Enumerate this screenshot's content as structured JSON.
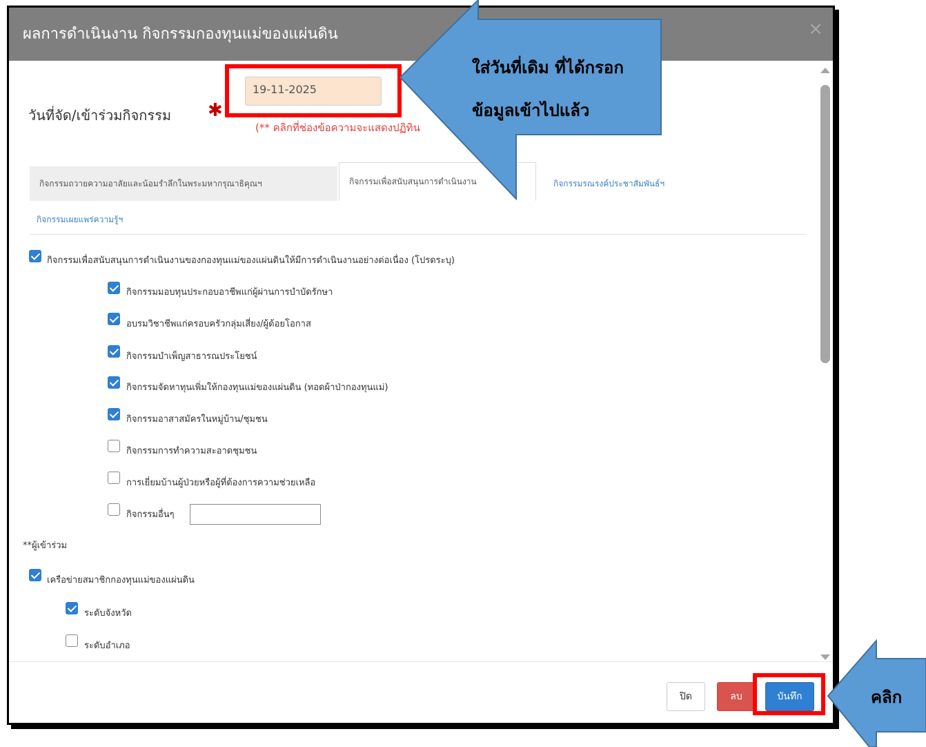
{
  "modal": {
    "title": "ผลการดำเนินงาน กิจกรรมกองทุนแม่ของแผ่นดิน",
    "close_glyph": "×"
  },
  "form": {
    "date_label": "วันที่จัด/เข้าร่วมกิจกรรม",
    "required_mark": "✱",
    "date_value": "19-11-2025",
    "hint": "(** คลิกที่ช่องข้อความจะแสดงปฏิทิน"
  },
  "tabs": [
    {
      "label": "กิจกรรมถวายความอาลัยและน้อมรำลึกในพระมหากรุณาธิคุณฯ",
      "state": "inactive"
    },
    {
      "label": "กิจกรรมเพื่อสนับสนุนการดำเนินงาน",
      "state": "active"
    },
    {
      "label": "กิจกรรมรณรงค์ประชาสัมพันธ์ฯ",
      "state": "link"
    },
    {
      "label": "กิจกรรมเผยแพร่ความรู้ฯ",
      "state": "link"
    }
  ],
  "main_checkbox": {
    "label": "กิจกรรมเพื่อสนับสนุนการดำเนินงานของกองทุนแม่ของแผ่นดินให้มีการดำเนินงานอย่างต่อเนื่อง (โปรดระบุ)",
    "checked": true
  },
  "sub_items": [
    {
      "label": "กิจกรรมมอบทุนประกอบอาชีพแก่ผู้ผ่านการบำบัดรักษา",
      "checked": true
    },
    {
      "label": "อบรมวิชาชีพแก่ครอบครัวกลุ่มเสี่ยง/ผู้ด้อยโอกาส",
      "checked": true
    },
    {
      "label": "กิจกรรมบำเพ็ญสาธารณประโยชน์",
      "checked": true
    },
    {
      "label": "กิจกรรมจัดหาทุนเพิ่มให้กองทุนแม่ของแผ่นดิน (ทอดผ้าป่ากองทุนแม่)",
      "checked": true
    },
    {
      "label": "กิจกรรมอาสาสมัครในหมู่บ้าน/ชุมชน",
      "checked": true
    },
    {
      "label": "กิจกรรมการทำความสะอาดชุมชน",
      "checked": false
    },
    {
      "label": "การเยี่ยมบ้านผู้ป่วยหรือผู้ที่ต้องการความช่วยเหลือ",
      "checked": false
    },
    {
      "label": "กิจกรรมอื่นๆ",
      "checked": false
    }
  ],
  "participants": {
    "heading": "**ผู้เข้าร่วม",
    "network": {
      "label": "เครือข่ายสมาชิกกองทุนแม่ของแผ่นดิน",
      "checked": true
    },
    "levels": [
      {
        "label": "ระดับจังหวัด",
        "checked": true
      },
      {
        "label": "ระดับอำเภอ",
        "checked": false
      }
    ]
  },
  "footer": {
    "close_label": "ปิด",
    "delete_label": "ลบ",
    "save_label": "บันทึก"
  },
  "annotations": {
    "arrow_top_line1": "ใส่วันที่เดิม ที่ได้กรอก",
    "arrow_top_line2": "ข้อมูลเข้าไปแล้ว",
    "arrow_bottom": "คลิก",
    "arrow_color": "#5b9bd5",
    "highlight_color": "#ff0000"
  }
}
